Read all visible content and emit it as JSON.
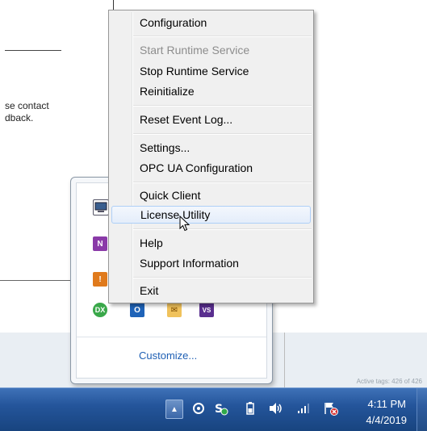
{
  "background": {
    "text_line1": "se contact",
    "text_line2": "dback.",
    "status_text": "Active tags: 426 of 426"
  },
  "menu": {
    "items": [
      {
        "label": "Configuration",
        "enabled": true
      },
      {
        "label": "Start Runtime Service",
        "enabled": false
      },
      {
        "label": "Stop Runtime Service",
        "enabled": true
      },
      {
        "label": "Reinitialize",
        "enabled": true
      },
      {
        "label": "Reset Event Log...",
        "enabled": true
      },
      {
        "label": "Settings...",
        "enabled": true
      },
      {
        "label": "OPC UA Configuration",
        "enabled": true
      },
      {
        "label": "Quick Client",
        "enabled": true
      },
      {
        "label": "License Utility",
        "enabled": true,
        "hover": true
      },
      {
        "label": "Help",
        "enabled": true
      },
      {
        "label": "Support Information",
        "enabled": true
      },
      {
        "label": "Exit",
        "enabled": true
      }
    ]
  },
  "flyout": {
    "customize_label": "Customize...",
    "icons": [
      "kepserver-icon",
      "onenote-icon",
      "alert-icon",
      "dx-icon",
      "outlook-icon",
      "mail-icon",
      "vs-icon"
    ]
  },
  "taskbar": {
    "time": "4:11 PM",
    "date": "4/4/2019"
  },
  "colors": {
    "taskbar": "#24559b",
    "menu_bg": "#f0f0f0",
    "link": "#1e5fb4"
  }
}
